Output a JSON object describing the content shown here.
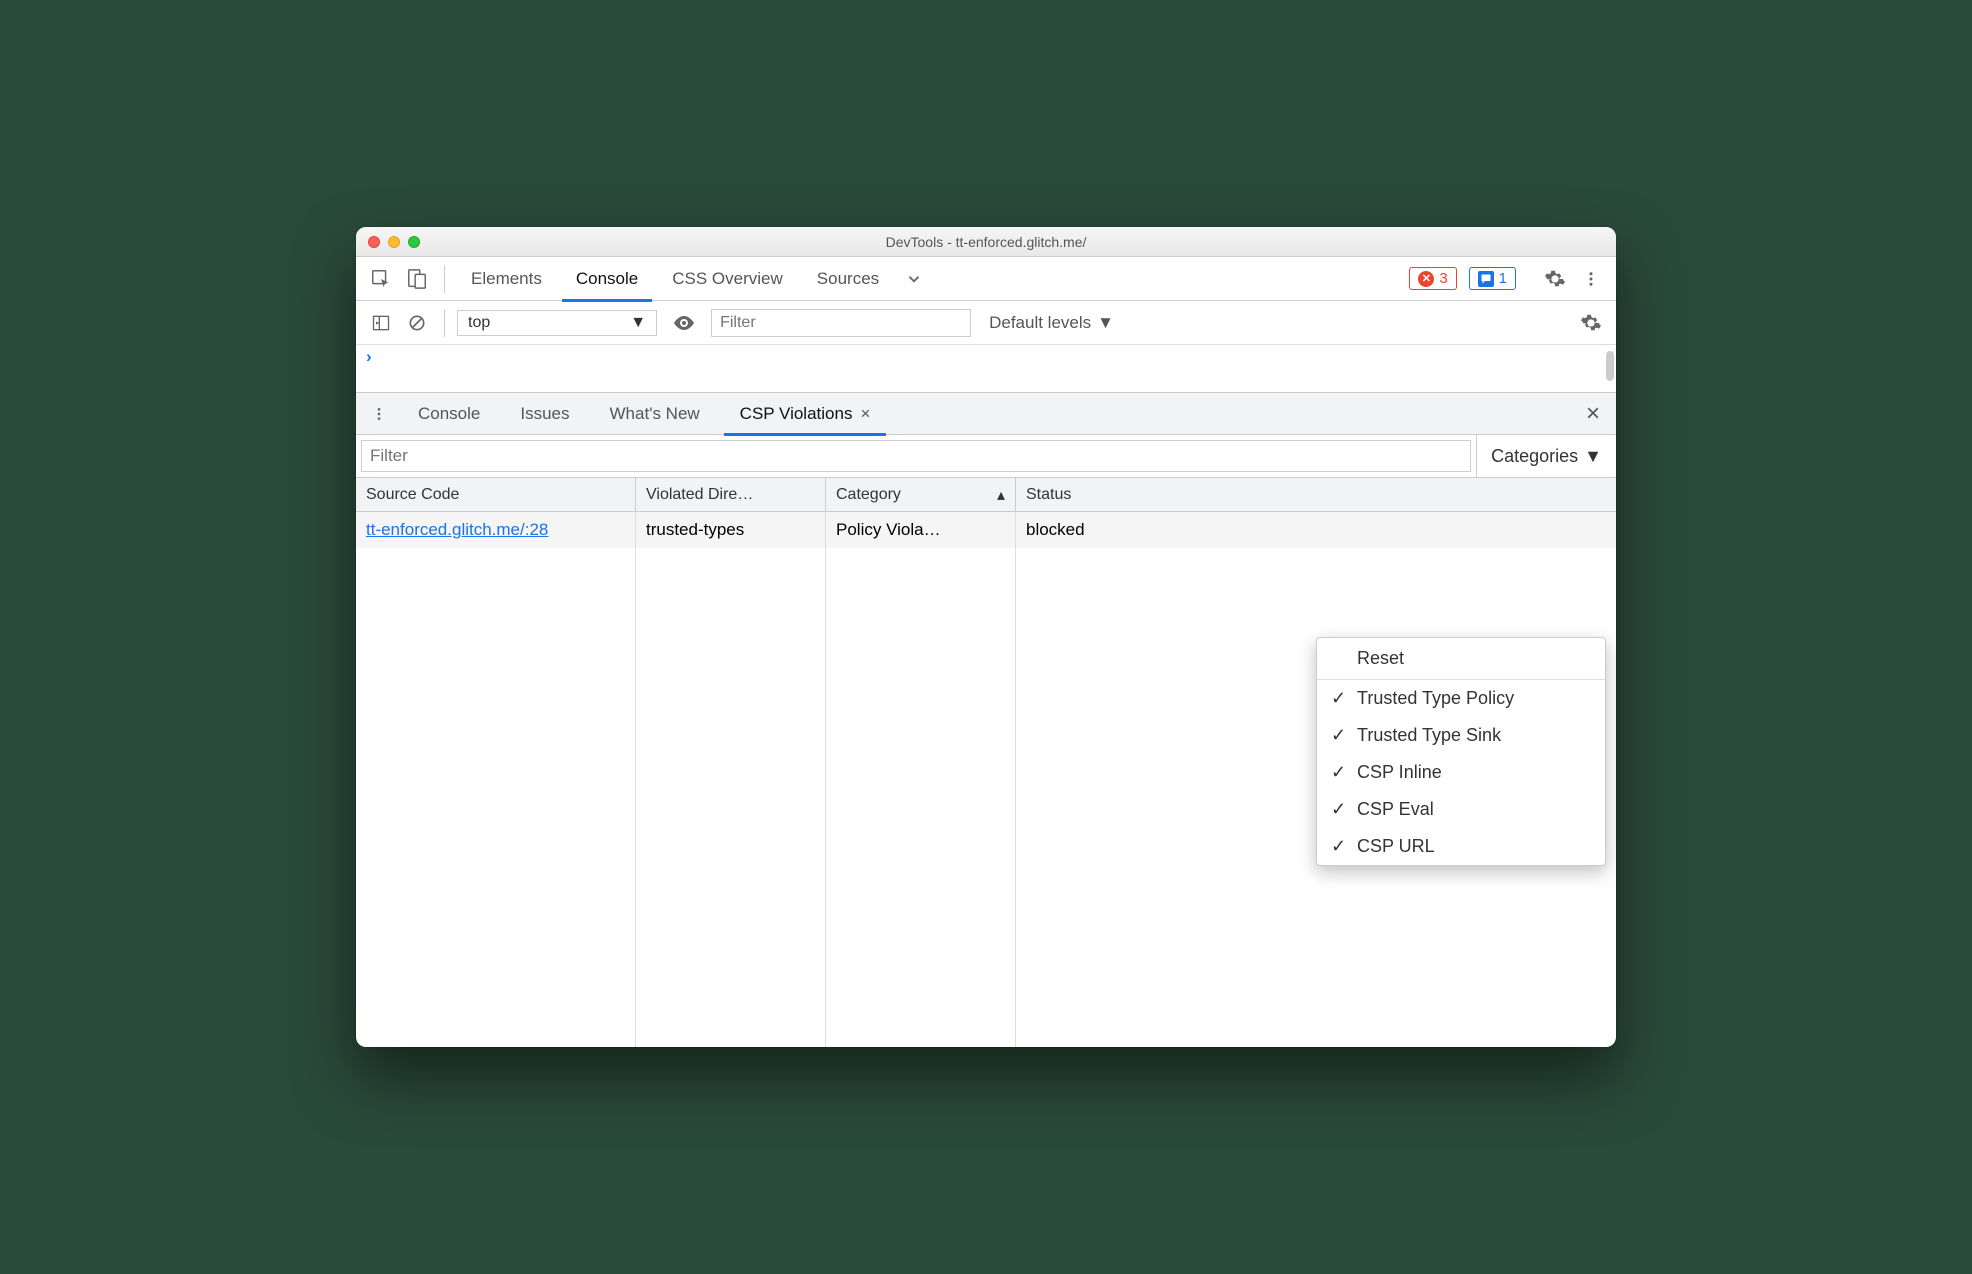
{
  "window": {
    "title": "DevTools - tt-enforced.glitch.me/"
  },
  "mainTabs": {
    "items": [
      "Elements",
      "Console",
      "CSS Overview",
      "Sources"
    ],
    "active": "Console",
    "errors": "3",
    "messages": "1"
  },
  "consoleToolbar": {
    "context": "top",
    "filterPlaceholder": "Filter",
    "levels": "Default levels"
  },
  "drawer": {
    "tabs": [
      "Console",
      "Issues",
      "What's New",
      "CSP Violations"
    ],
    "active": "CSP Violations"
  },
  "cspPanel": {
    "filterPlaceholder": "Filter",
    "categoriesLabel": "Categories",
    "columns": {
      "source": "Source Code",
      "directive": "Violated Dire…",
      "category": "Category",
      "status": "Status"
    },
    "rows": [
      {
        "source": "tt-enforced.glitch.me/:28",
        "directive": "trusted-types",
        "category": "Policy Viola…",
        "status": "blocked"
      }
    ],
    "menu": {
      "reset": "Reset",
      "items": [
        "Trusted Type Policy",
        "Trusted Type Sink",
        "CSP Inline",
        "CSP Eval",
        "CSP URL"
      ]
    }
  }
}
